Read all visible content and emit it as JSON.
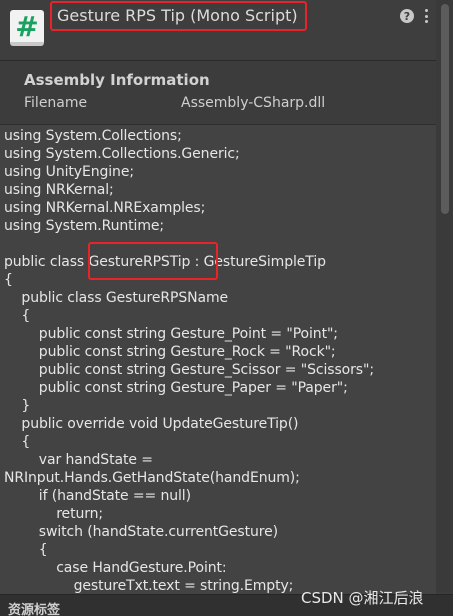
{
  "header": {
    "icon_glyph": "#",
    "icon_name": "csharp-script-icon",
    "title": "Gesture RPS Tip (Mono Script)",
    "help_glyph": "?"
  },
  "assembly": {
    "heading": "Assembly Information",
    "filename_key": "Filename",
    "filename_value": "Assembly-CSharp.dll"
  },
  "code": {
    "lines": [
      "using System.Collections;",
      "using System.Collections.Generic;",
      "using UnityEngine;",
      "using NRKernal;",
      "using NRKernal.NRExamples;",
      "using System.Runtime;",
      "",
      "public class GestureRPSTip : GestureSimpleTip",
      "{",
      "    public class GestureRPSName",
      "    {",
      "        public const string Gesture_Point = \"Point\";",
      "        public const string Gesture_Rock = \"Rock\";",
      "        public const string Gesture_Scissor = \"Scissors\";",
      "        public const string Gesture_Paper = \"Paper\";",
      "    }",
      "    public override void UpdateGestureTip()",
      "    {",
      "        var handState =",
      "NRInput.Hands.GetHandState(handEnum);",
      "        if (handState == null)",
      "            return;",
      "        switch (handState.currentGesture)",
      "        {",
      "            case HandGesture.Point:",
      "                gestureTxt.text = string.Empty;"
    ]
  },
  "footer": {
    "label": "资源标签"
  },
  "watermark": "CSDN @湘江后浪",
  "colors": {
    "highlight_border": "#e8232a",
    "script_icon_green": "#19a15f"
  }
}
